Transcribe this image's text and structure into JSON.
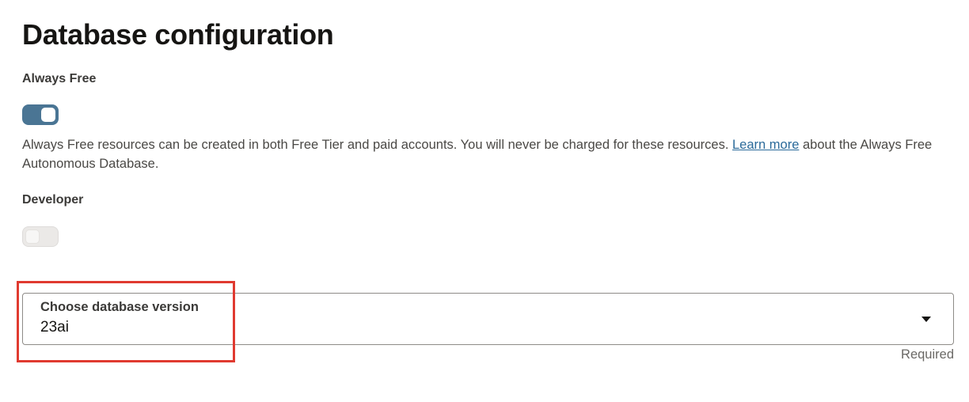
{
  "page": {
    "title": "Database configuration"
  },
  "always_free": {
    "label": "Always Free",
    "toggle_on": true,
    "description_before": "Always Free resources can be created in both Free Tier and paid accounts. You will never be charged for these resources. ",
    "link_text": "Learn more",
    "description_after": " about the Always Free Autonomous Database."
  },
  "developer": {
    "label": "Developer",
    "toggle_on": false
  },
  "db_version": {
    "label": "Choose database version",
    "value": "23ai",
    "required_text": "Required"
  },
  "colors": {
    "toggle_on": "#4a7594",
    "link": "#2b6a9a",
    "highlight": "#e03a30"
  }
}
